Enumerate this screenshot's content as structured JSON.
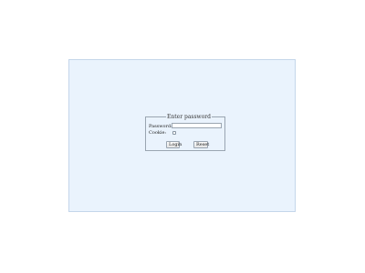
{
  "login_form": {
    "legend": "Enter password",
    "password_label": "Password:",
    "password_value": "",
    "cookie_label": "Cookie:",
    "cookie_checked": false,
    "login_label": "Login",
    "reset_label": "Reset"
  },
  "colors": {
    "panel_background": "#eaf3fd",
    "panel_border": "#c4d6ea",
    "fieldset_border": "#9aa5b1"
  }
}
